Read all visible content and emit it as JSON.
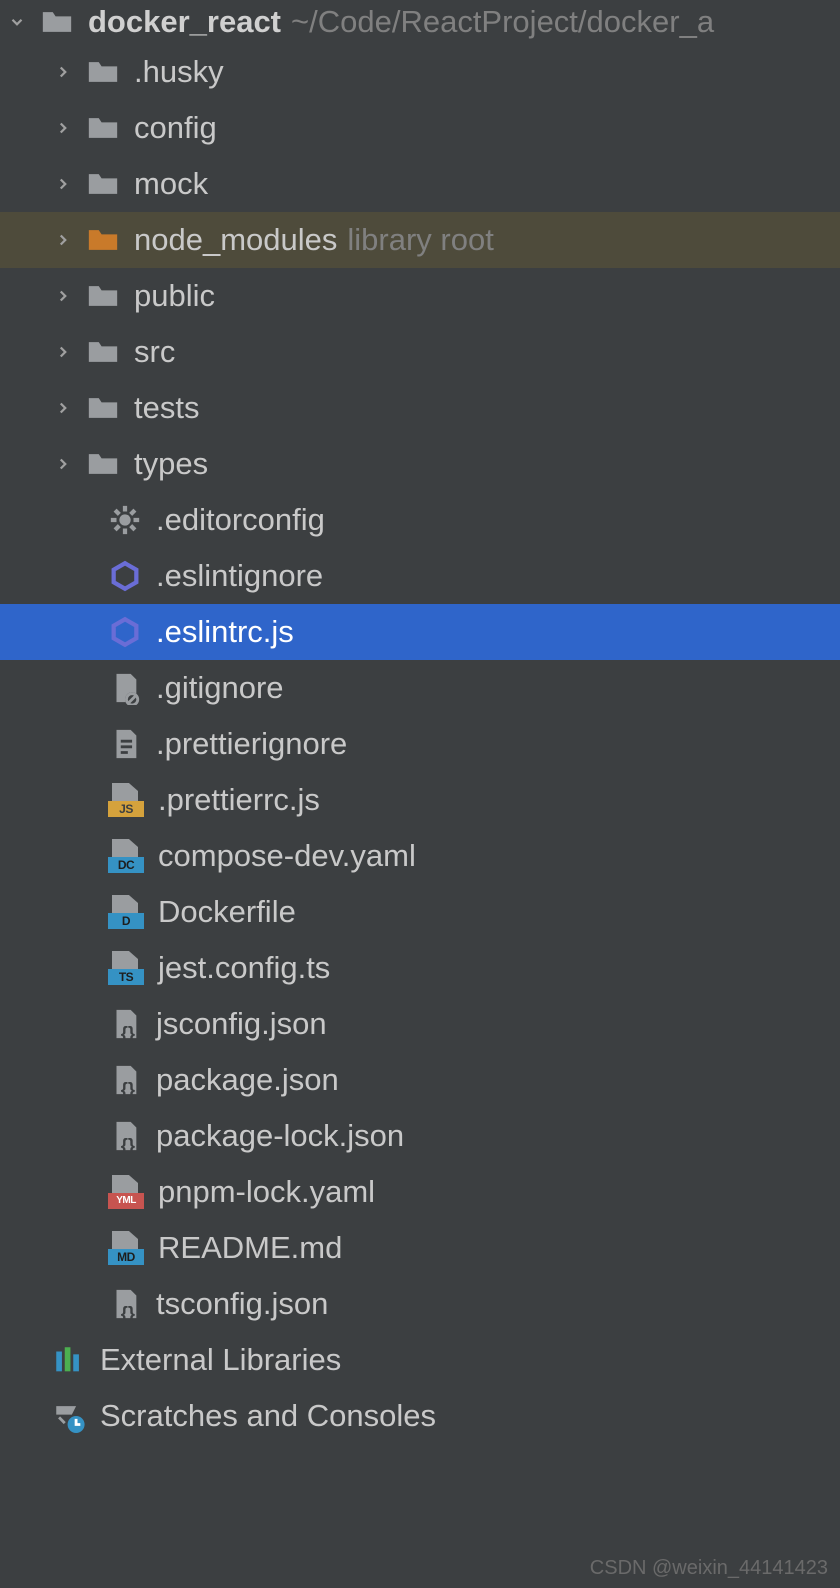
{
  "root": {
    "name": "docker_react",
    "path": "~/Code/ReactProject/docker_a"
  },
  "folders": [
    {
      "name": ".husky",
      "icon": "gray",
      "highlighted": false,
      "hint": ""
    },
    {
      "name": "config",
      "icon": "gray",
      "highlighted": false,
      "hint": ""
    },
    {
      "name": "mock",
      "icon": "gray",
      "highlighted": false,
      "hint": ""
    },
    {
      "name": "node_modules",
      "icon": "orange",
      "highlighted": true,
      "hint": "library root"
    },
    {
      "name": "public",
      "icon": "gray",
      "highlighted": false,
      "hint": ""
    },
    {
      "name": "src",
      "icon": "gray",
      "highlighted": false,
      "hint": ""
    },
    {
      "name": "tests",
      "icon": "gray",
      "highlighted": false,
      "hint": ""
    },
    {
      "name": "types",
      "icon": "gray",
      "highlighted": false,
      "hint": ""
    }
  ],
  "files": [
    {
      "name": ".editorconfig",
      "icon": "gear",
      "selected": false
    },
    {
      "name": ".eslintignore",
      "icon": "eslint",
      "selected": false
    },
    {
      "name": ".eslintrc.js",
      "icon": "eslint",
      "selected": true
    },
    {
      "name": ".gitignore",
      "icon": "gitignore",
      "selected": false
    },
    {
      "name": ".prettierignore",
      "icon": "textfile",
      "selected": false
    },
    {
      "name": ".prettierrc.js",
      "icon": "badge",
      "badge": "JS",
      "badgeClass": "js",
      "selected": false
    },
    {
      "name": "compose-dev.yaml",
      "icon": "badge",
      "badge": "DC",
      "badgeClass": "dc",
      "selected": false
    },
    {
      "name": "Dockerfile",
      "icon": "badge",
      "badge": "D",
      "badgeClass": "d",
      "selected": false
    },
    {
      "name": "jest.config.ts",
      "icon": "badge",
      "badge": "TS",
      "badgeClass": "ts",
      "selected": false
    },
    {
      "name": "jsconfig.json",
      "icon": "json",
      "selected": false
    },
    {
      "name": "package.json",
      "icon": "json",
      "selected": false
    },
    {
      "name": "package-lock.json",
      "icon": "json",
      "selected": false
    },
    {
      "name": "pnpm-lock.yaml",
      "icon": "badge",
      "badge": "YML",
      "badgeClass": "yml",
      "selected": false
    },
    {
      "name": "README.md",
      "icon": "badge",
      "badge": "MD",
      "badgeClass": "md",
      "selected": false
    },
    {
      "name": "tsconfig.json",
      "icon": "json",
      "selected": false
    }
  ],
  "bottom": [
    {
      "name": "External Libraries",
      "icon": "libraries"
    },
    {
      "name": "Scratches and Consoles",
      "icon": "scratches"
    }
  ],
  "watermark": "CSDN @weixin_44141423"
}
